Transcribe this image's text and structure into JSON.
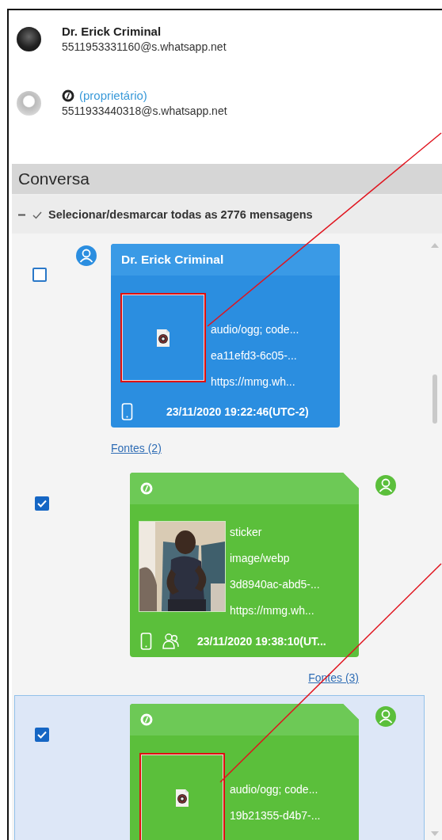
{
  "contacts": [
    {
      "name": "Dr. Erick Criminal",
      "address": "5511953331160@s.whatsapp.net"
    },
    {
      "kind": "owner",
      "name": "(proprietário)",
      "address": "5511933440318@s.whatsapp.net"
    }
  ],
  "section_title": "Conversa",
  "select_all": {
    "label": "Selecionar/desmarcar todas as 2776 mensagens"
  },
  "messages": [
    {
      "kind": "incoming",
      "checked": false,
      "selected": false,
      "sender": "Dr. Erick Criminal",
      "attachment": {
        "kind": "audio",
        "highlighted": true,
        "lines": [
          "audio/ogg; code...",
          "ea11efd3-6c05-...",
          "https://mmg.wh..."
        ]
      },
      "group": false,
      "timestamp": "23/11/2020 19:22:46(UTC-2)",
      "sources": "Fontes (2)"
    },
    {
      "kind": "outgoing",
      "checked": true,
      "selected": false,
      "attachment": {
        "kind": "sticker",
        "highlighted": false,
        "lines": [
          "sticker",
          "image/webp",
          "3d8940ac-abd5-...",
          "https://mmg.wh..."
        ]
      },
      "group": true,
      "timestamp": "23/11/2020 19:38:10(UT...",
      "sources": "Fontes (3)"
    },
    {
      "kind": "outgoing",
      "checked": true,
      "selected": true,
      "attachment": {
        "kind": "audio",
        "highlighted": true,
        "lines": [
          "audio/ogg; code...",
          "19b21355-d4b7-..."
        ]
      }
    }
  ]
}
